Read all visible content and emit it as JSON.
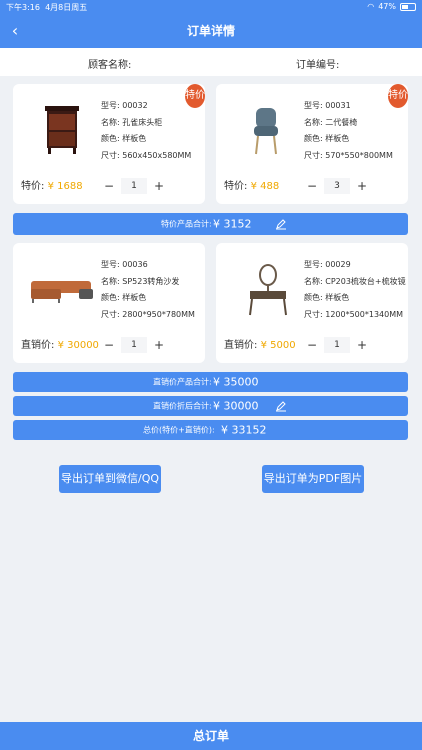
{
  "status": {
    "time": "下午3:16",
    "date": "4月8日周五",
    "battery": "47%"
  },
  "title": "订单详情",
  "info": {
    "customer_label": "顾客名称:",
    "order_label": "订单编号:"
  },
  "products": [
    {
      "type": "型号: 00032",
      "name": "名称: 孔雀床头柜",
      "color": "颜色: 样板色",
      "size": "尺寸: 560x450x580MM",
      "price_label": "特价:",
      "price": "¥ 1688",
      "qty": "1",
      "badge": "特价"
    },
    {
      "type": "型号: 00031",
      "name": "名称: 二代餐椅",
      "color": "颜色: 样板色",
      "size": "尺寸: 570*550*800MM",
      "price_label": "特价:",
      "price": "¥ 488",
      "qty": "3",
      "badge": "特价"
    },
    {
      "type": "型号: 00036",
      "name": "名称: SP523转角沙发",
      "color": "颜色: 样板色",
      "size": "尺寸: 2800*950*780MM",
      "price_label": "直销价:",
      "price": "¥ 30000",
      "qty": "1"
    },
    {
      "type": "型号: 00029",
      "name": "名称: CP203梳妆台+梳妆镜",
      "color": "颜色: 样板色",
      "size": "尺寸: 1200*500*1340MM",
      "price_label": "直销价:",
      "price": "¥ 5000",
      "qty": "1"
    }
  ],
  "summaries": {
    "special_label": "特价产品合计:",
    "special_value": "¥ 3152",
    "direct_label": "直销价产品合计:",
    "direct_value": "¥ 35000",
    "discount_label": "直销价折后合计:",
    "discount_value": "¥ 30000",
    "total_label": "总价(特价+直销价):",
    "total_value": "¥ 33152"
  },
  "buttons": {
    "export_wechat": "导出订单到微信/QQ",
    "export_pdf": "导出订单为PDF图片",
    "total_order": "总订单"
  },
  "stepper": {
    "minus": "−",
    "plus": "+"
  },
  "colors": {
    "primary": "#4a8cf0",
    "price": "#f0a800",
    "badge": "#e25a2e"
  }
}
